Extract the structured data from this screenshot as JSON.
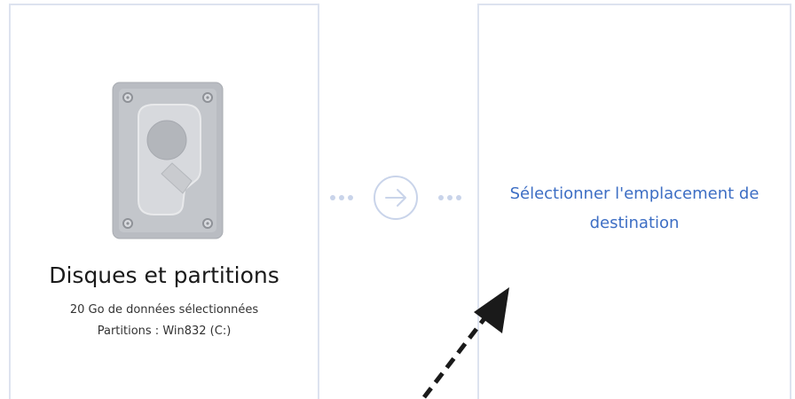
{
  "source": {
    "title": "Disques et partitions",
    "detail_size": "20 Go de données sélectionnées",
    "detail_partitions": "Partitions : Win832 (C:)",
    "icon": "hard-drive-icon"
  },
  "connector": {
    "icon": "arrow-right-circle-icon"
  },
  "destination": {
    "label": "Sélectionner l'emplacement de destination"
  },
  "colors": {
    "border": "#dde3ef",
    "accent": "#3d6ec4",
    "connector": "#c9d4ea"
  }
}
